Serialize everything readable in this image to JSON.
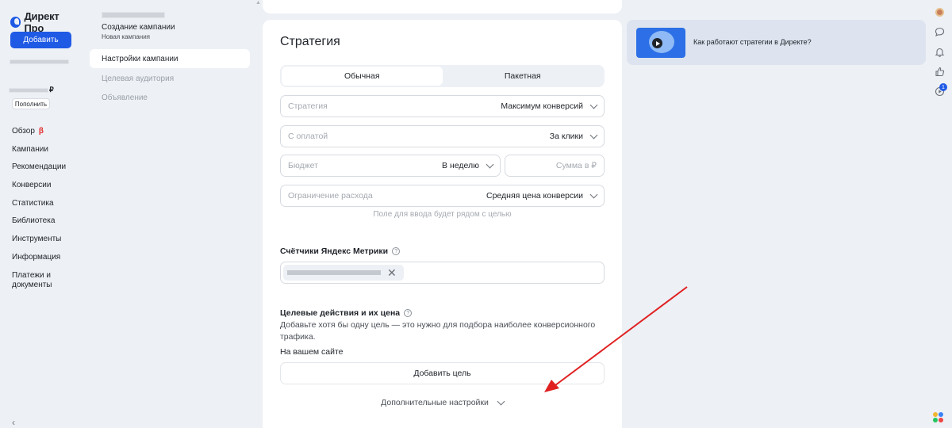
{
  "sidebar": {
    "logo": "Директ Про",
    "add_button": "Добавить",
    "balance_currency": "₽",
    "topup_button": "Пополнить",
    "beta_mark": "β",
    "nav": [
      {
        "label": "Обзор",
        "beta": true
      },
      {
        "label": "Кампании"
      },
      {
        "label": "Рекомендации"
      },
      {
        "label": "Конверсии"
      },
      {
        "label": "Статистика"
      },
      {
        "label": "Библиотека"
      },
      {
        "label": "Инструменты"
      },
      {
        "label": "Информация"
      },
      {
        "label": "Платежи и документы"
      }
    ],
    "collapse_icon": "chevron-left-icon"
  },
  "steps": {
    "title": "Создание кампании",
    "subtitle": "Новая кампания",
    "items": [
      {
        "label": "Настройки кампании",
        "active": true
      },
      {
        "label": "Целевая аудитория"
      },
      {
        "label": "Объявление"
      }
    ]
  },
  "strategy": {
    "title": "Стратегия",
    "tabs": [
      {
        "label": "Обычная",
        "active": true
      },
      {
        "label": "Пакетная"
      }
    ],
    "strategy_field": {
      "label": "Стратегия",
      "value": "Максимум конверсий"
    },
    "payment_field": {
      "label": "С оплатой",
      "value": "За клики"
    },
    "budget_field": {
      "label": "Бюджет",
      "value": "В неделю"
    },
    "amount_field": {
      "placeholder": "Сумма в ₽"
    },
    "limit_field": {
      "label": "Ограничение расхода",
      "value": "Средняя цена конверсии"
    },
    "hint": "Поле для ввода будет рядом с целью"
  },
  "metrika": {
    "title": "Счётчики Яндекс Метрики",
    "help_icon": "?"
  },
  "goals": {
    "title": "Целевые действия и их цена",
    "help_icon": "?",
    "description": "Добавьте хотя бы одну цель — это нужно для подбора наиболее конверсионного трафика.",
    "on_site": "На вашем сайте",
    "add_button": "Добавить цель",
    "more_settings": "Дополнительные настройки"
  },
  "help_widget": {
    "text": "Как работают стратегии в Директе?"
  },
  "rail": {
    "notifications_count": "1",
    "icons": [
      "avatar",
      "chat-icon",
      "bell-icon",
      "like-icon",
      "video-icon"
    ]
  },
  "colors": {
    "primary": "#1f5ae5",
    "background": "#edf0f5",
    "annotation_arrow": "#e02020"
  }
}
